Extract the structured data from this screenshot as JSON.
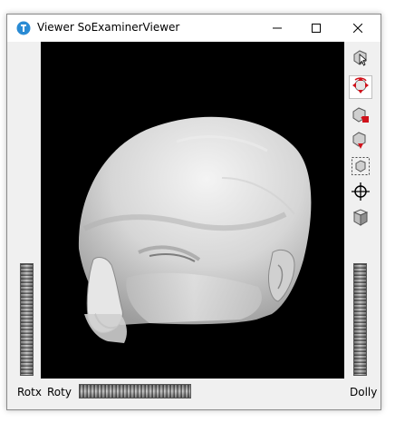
{
  "window": {
    "title": "Viewer SoExaminerViewer",
    "app_icon": "qt-logo-icon",
    "controls": [
      "minimize-icon",
      "maximize-icon",
      "close-icon"
    ]
  },
  "toolbar": {
    "tools": [
      {
        "name": "pick-mode",
        "icon": "pointer-arrow-icon",
        "active": false
      },
      {
        "name": "view-mode",
        "icon": "rotate-arrows-icon",
        "active": true
      },
      {
        "name": "home",
        "icon": "home-view-icon",
        "active": false
      },
      {
        "name": "set-home",
        "icon": "set-home-icon",
        "active": false
      },
      {
        "name": "view-all",
        "icon": "view-all-icon",
        "active": false
      },
      {
        "name": "seek",
        "icon": "crosshair-icon",
        "active": false
      },
      {
        "name": "projection",
        "icon": "perspective-cube-icon",
        "active": false
      }
    ]
  },
  "bottom": {
    "rotx_label": "Rotx",
    "roty_label": "Roty",
    "dolly_label": "Dolly"
  },
  "colors": {
    "viewport_background": "#000000",
    "model_color": "#d9d9d9",
    "window_background": "#f0f0f0"
  }
}
